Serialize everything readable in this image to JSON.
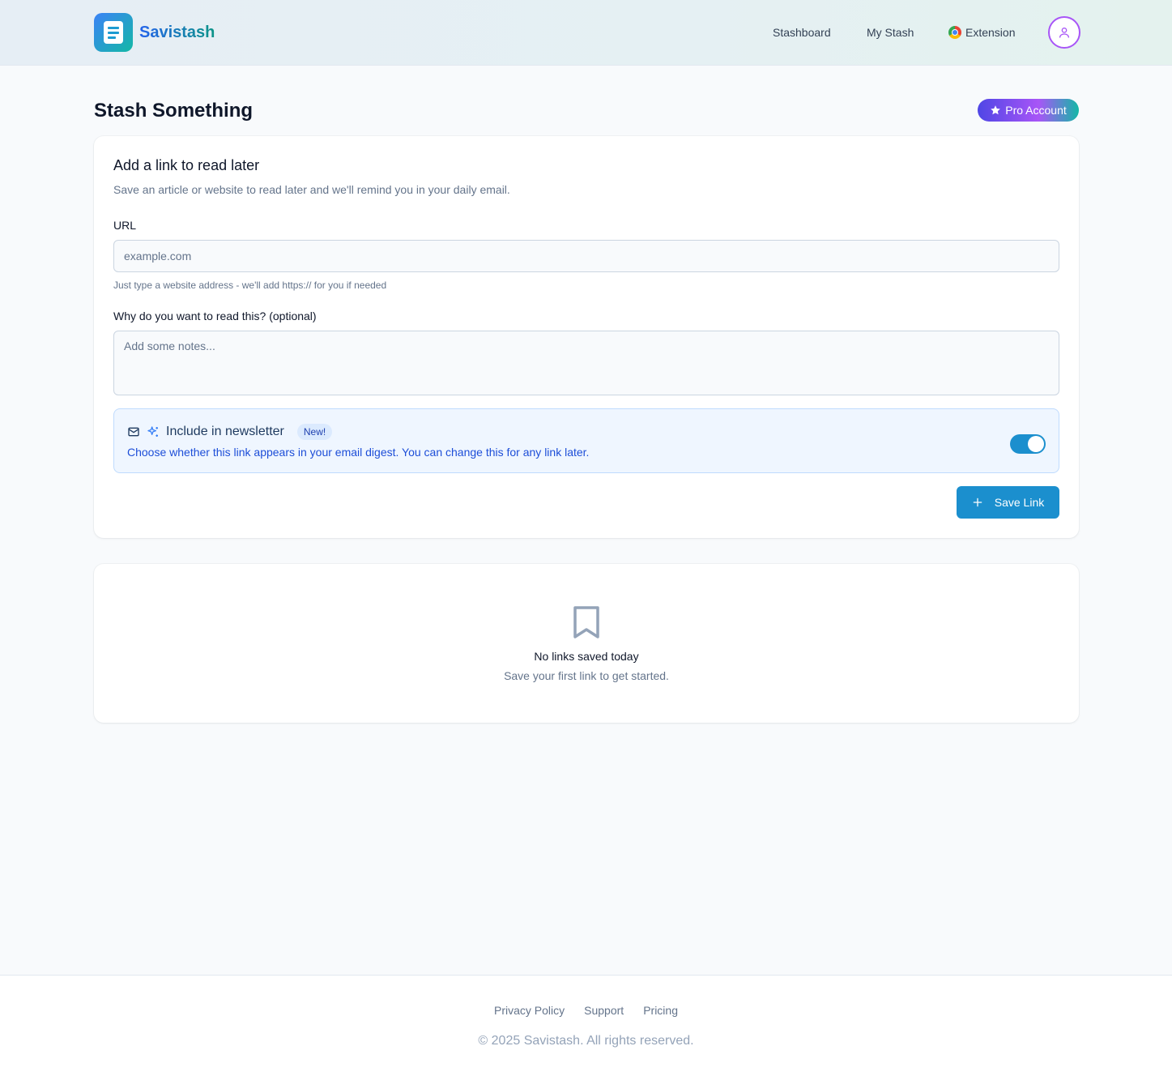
{
  "header": {
    "brand": "Savistash",
    "nav": {
      "stashboard": "Stashboard",
      "my_stash": "My Stash",
      "extension": "Extension"
    }
  },
  "page": {
    "title": "Stash Something",
    "pro_badge": "Pro Account"
  },
  "form": {
    "title": "Add a link to read later",
    "subtitle": "Save an article or website to read later and we'll remind you in your daily email.",
    "url_label": "URL",
    "url_value": "",
    "url_placeholder": "example.com",
    "url_hint": "Just type a website address - we'll add https:// for you if needed",
    "notes_label": "Why do you want to read this? (optional)",
    "notes_value": "",
    "notes_placeholder": "Add some notes...",
    "newsletter": {
      "title": "Include in newsletter",
      "badge": "New!",
      "description": "Choose whether this link appears in your email digest. You can change this for any link later.",
      "enabled": true
    },
    "save_label": "Save Link"
  },
  "empty_state": {
    "title": "No links saved today",
    "subtitle": "Save your first link to get started."
  },
  "footer": {
    "links": [
      "Privacy Policy",
      "Support",
      "Pricing"
    ],
    "copyright": "© 2025 Savistash. All rights reserved."
  },
  "colors": {
    "primary": "#1b8fce",
    "brand_gradient_start": "#3b82f6",
    "brand_gradient_end": "#14b8a6",
    "avatar_ring": "#a855f7"
  },
  "icons": {
    "logo": "document-icon",
    "extension": "chrome-icon",
    "avatar": "user-icon",
    "pro": "star-icon",
    "newsletter_mail": "mail-icon",
    "newsletter_sparkle": "sparkles-icon",
    "save": "plus-icon",
    "empty": "bookmark-icon"
  }
}
